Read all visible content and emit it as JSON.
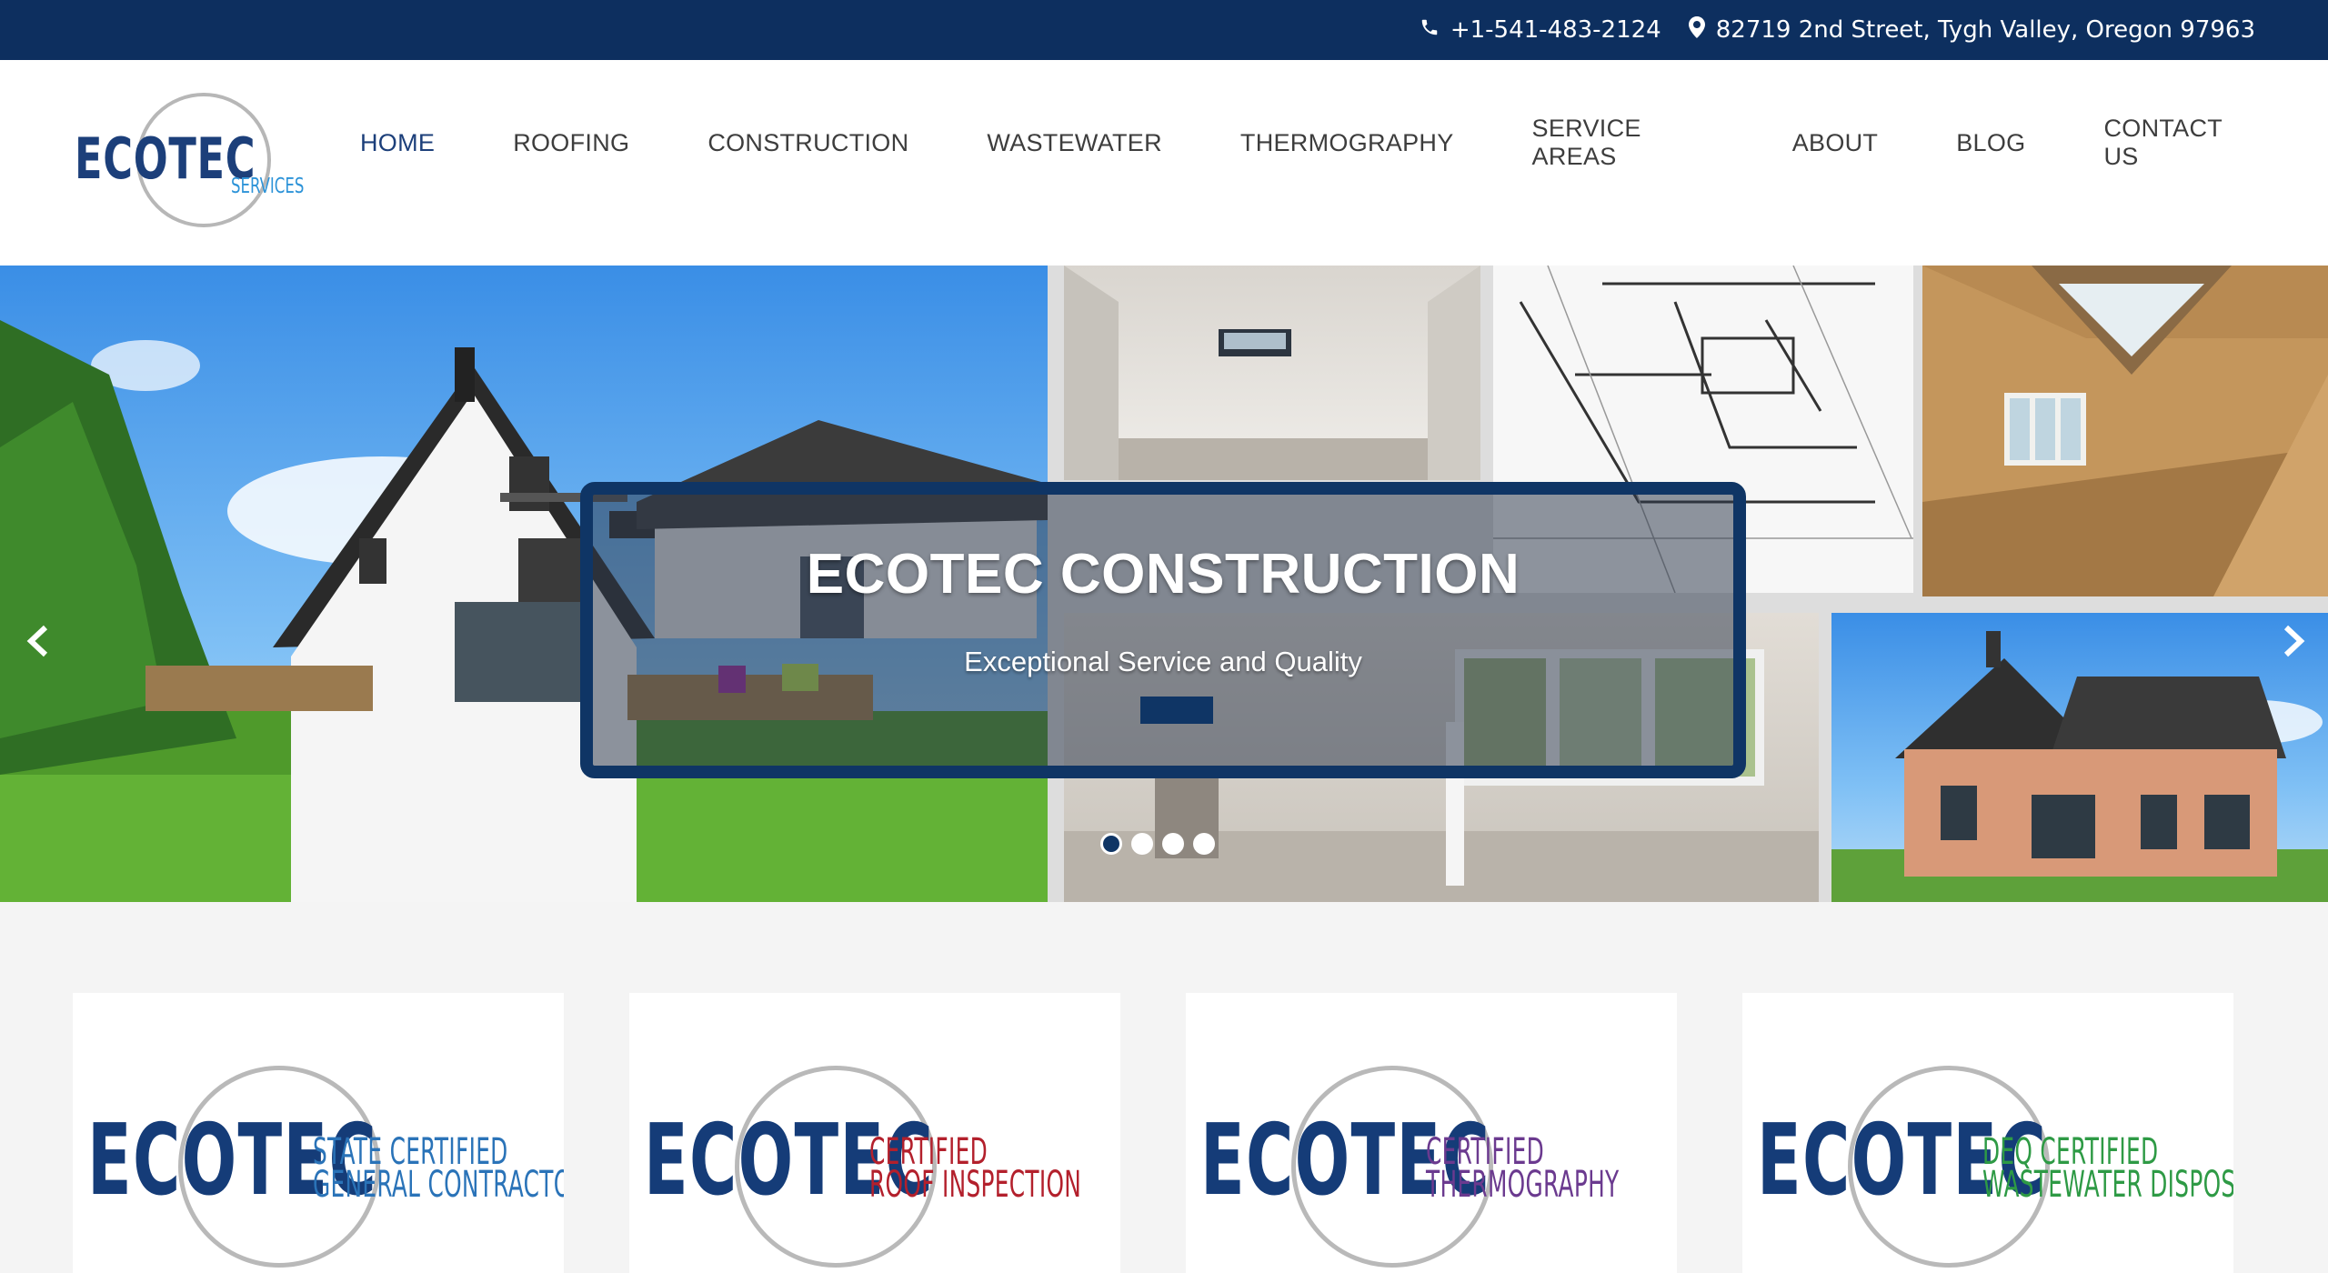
{
  "topbar": {
    "phone": "+1-541-483-2124",
    "address": "82719 2nd Street, Tygh Valley, Oregon 97963",
    "phone_icon": "phone-icon",
    "location_icon": "map-pin-icon"
  },
  "logo": {
    "brand": "ECOTEC",
    "sub": "SERVICES"
  },
  "nav": {
    "items": [
      {
        "label": "HOME",
        "active": true
      },
      {
        "label": "ROOFING"
      },
      {
        "label": "CONSTRUCTION"
      },
      {
        "label": "WASTEWATER"
      },
      {
        "label": "THERMOGRAPHY"
      },
      {
        "label": "SERVICE AREAS"
      },
      {
        "label": "ABOUT"
      },
      {
        "label": "BLOG"
      },
      {
        "label": "CONTACT US"
      }
    ]
  },
  "hero": {
    "title": "ECOTEC CONSTRUCTION",
    "subtitle": "Exceptional Service and Quality",
    "prev_icon": "chevron-left-icon",
    "next_icon": "chevron-right-icon",
    "slide_count": 4,
    "active_slide": 1
  },
  "cards": [
    {
      "brand": "ECOTEC",
      "line1": "STATE CERTIFIED",
      "line2": "GENERAL CONTRACTOR",
      "color": "#2a73b8"
    },
    {
      "brand": "ECOTEC",
      "line1": "CERTIFIED",
      "line2": "ROOF INSPECTION",
      "color": "#b3202c"
    },
    {
      "brand": "ECOTEC",
      "line1": "CERTIFIED",
      "line2": "THERMOGRAPHY",
      "color": "#6b3a8f"
    },
    {
      "brand": "ECOTEC",
      "line1": "DEQ CERTIFIED",
      "line2": "WASTEWATER DISPOSAL",
      "color": "#2e9a45"
    }
  ],
  "colors": {
    "navy": "#0d2f5f",
    "brand_blue": "#1c3f7a",
    "accent_blue": "#2d93d8"
  }
}
